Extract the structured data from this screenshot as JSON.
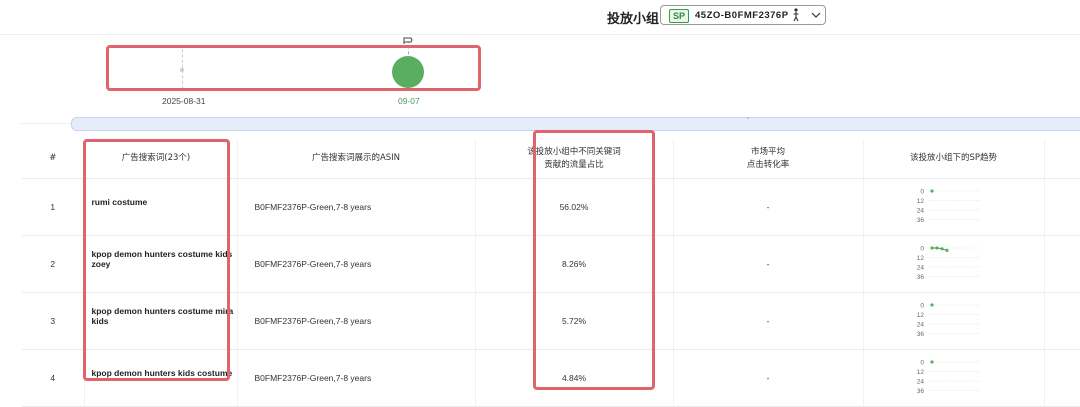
{
  "header": {
    "group_label": "投放小组",
    "group_badge": "SP",
    "group_value": "45ZO-B0FMF2376P"
  },
  "timeline": {
    "dates": [
      "2025-08-31",
      "09-07"
    ]
  },
  "table": {
    "columns": [
      "#",
      "广告搜索词(23个)",
      "广告搜索词展示的ASIN",
      "该投放小组中不同关键词贡献的流量占比",
      "市场平均点击转化率",
      "该投放小组下的SP趋势",
      ""
    ],
    "column_lines": {
      "share": [
        "该投放小组中不同关键词",
        "贡献的流量占比"
      ],
      "cvr": [
        "市场平均",
        "点击转化率"
      ]
    },
    "rows": [
      {
        "index": "1",
        "keyword": "rumi costume",
        "asin": "B0FMF2376P-Green,7-8 years",
        "share": "56.02%",
        "cvr": "-",
        "trend": [
          0
        ]
      },
      {
        "index": "2",
        "keyword": "kpop demon hunters costume kids zoey",
        "asin": "B0FMF2376P-Green,7-8 years",
        "share": "8.26%",
        "cvr": "-",
        "trend": [
          0,
          0,
          1,
          3
        ]
      },
      {
        "index": "3",
        "keyword": "kpop demon hunters costume mira kids",
        "asin": "B0FMF2376P-Green,7-8 years",
        "share": "5.72%",
        "cvr": "-",
        "trend": [
          0
        ]
      },
      {
        "index": "4",
        "keyword": "kpop demon hunters kids costume",
        "asin": "B0FMF2376P-Green,7-8 years",
        "share": "4.84%",
        "cvr": "-",
        "trend": [
          0
        ]
      }
    ],
    "trend_axis": [
      "0",
      "12",
      "24",
      "36"
    ]
  },
  "colors": {
    "accent_green": "#5aae5f",
    "highlight_red": "#e0646c",
    "scroll_blue": "#e6ecf9"
  }
}
